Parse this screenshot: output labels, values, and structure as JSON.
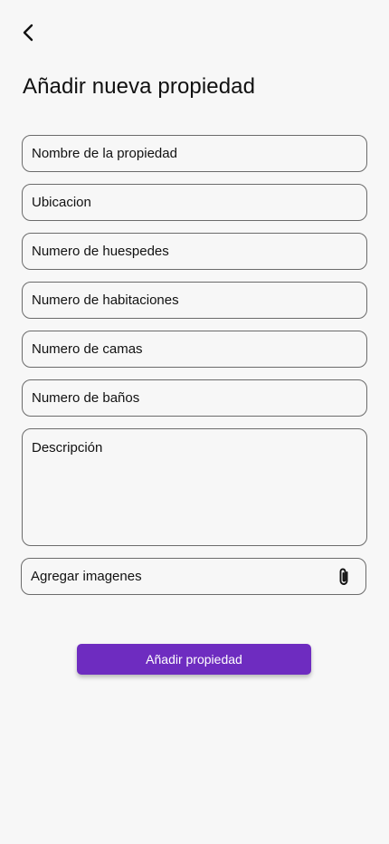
{
  "header": {
    "back_icon": "chevron-left-icon",
    "title": "Añadir nueva propiedad"
  },
  "form": {
    "property_name": {
      "placeholder": "Nombre de la propiedad",
      "value": ""
    },
    "location": {
      "placeholder": "Ubicacion",
      "value": ""
    },
    "guests": {
      "placeholder": "Numero de huespedes",
      "value": ""
    },
    "rooms": {
      "placeholder": "Numero de habitaciones",
      "value": ""
    },
    "beds": {
      "placeholder": "Numero de camas",
      "value": ""
    },
    "bathrooms": {
      "placeholder": "Numero de baños",
      "value": ""
    },
    "description": {
      "placeholder": "Descripción",
      "value": ""
    },
    "images": {
      "label": "Agregar imagenes",
      "icon": "paperclip-icon"
    }
  },
  "actions": {
    "submit_label": "Añadir propiedad",
    "submit_color": "#6e2cc0"
  }
}
